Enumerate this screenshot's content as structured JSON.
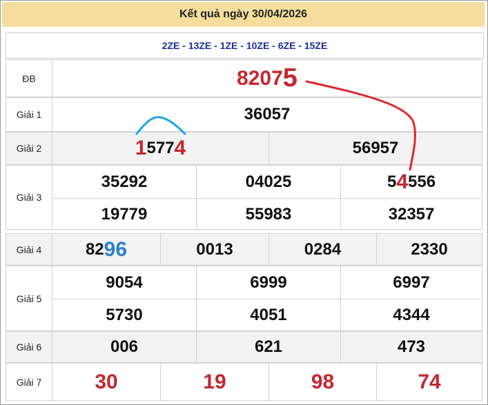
{
  "title": "Kết quả ngày 30/04/2026",
  "codes": "2ZE - 13ZE - 1ZE - 10ZE - 6ZE - 15ZE",
  "labels": {
    "db": "ĐB",
    "g1": "Giải 1",
    "g2": "Giải 2",
    "g3": "Giải 3",
    "g4": "Giải 4",
    "g5": "Giải 5",
    "g6": "Giải 6",
    "g7": "Giải 7"
  },
  "db": {
    "prefix": "8207",
    "last": "5"
  },
  "g1": [
    "36057"
  ],
  "g2": [
    {
      "first": "1",
      "middle": "577",
      "last": "4"
    },
    {
      "value": "56957"
    }
  ],
  "g3": {
    "row1": [
      "35292",
      "04025"
    ],
    "row1_c3": {
      "a": "5",
      "b": "4",
      "c": "556"
    },
    "row2": [
      "19779",
      "55983",
      "32357"
    ]
  },
  "g4": {
    "c1": {
      "a": "82",
      "b": "96"
    },
    "rest": [
      "0013",
      "0284",
      "2330"
    ]
  },
  "g5": {
    "row1": [
      "9054",
      "6999",
      "6997"
    ],
    "row2": [
      "5730",
      "4051",
      "4344"
    ]
  },
  "g6": [
    "006",
    "621",
    "473"
  ],
  "g7": [
    "30",
    "19",
    "98",
    "74"
  ],
  "colors": {
    "title_bg": "#f5dd9d",
    "accent_red": "#c3282e",
    "accent_blue": "#2a7fd4",
    "code_blue": "#1a2e9e"
  }
}
